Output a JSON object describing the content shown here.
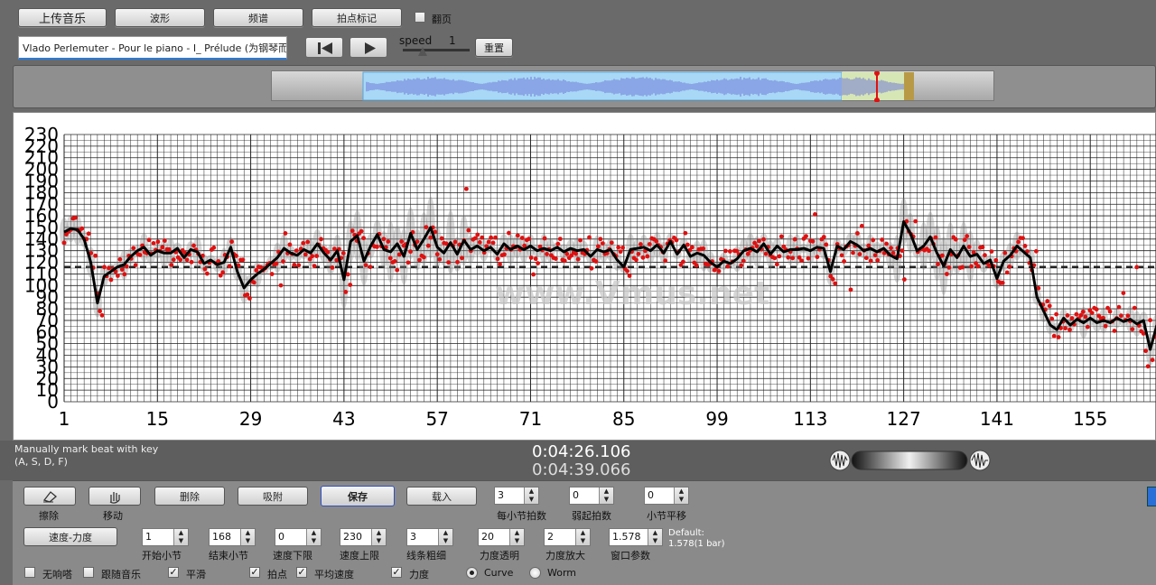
{
  "toolbar": {
    "upload": "上传音乐",
    "waveform": "波形",
    "spectrum": "频谱",
    "beat_mark": "拍点标记",
    "page_turn": "翻页",
    "page_turn_checked": false
  },
  "track": {
    "title": "Vlado Perlemuter - Pour le piano - I_ Prélude (为钢琴而作 - 前奏曲)",
    "speed_label": "speed",
    "speed_value": "1",
    "reset_label": "重置"
  },
  "watermark": "www.Vmus.net",
  "chart_data": {
    "type": "line+scatter",
    "yticks": [
      0,
      10,
      20,
      30,
      40,
      50,
      60,
      70,
      80,
      90,
      100,
      110,
      120,
      130,
      140,
      150,
      160,
      170,
      180,
      190,
      200,
      210,
      220,
      230
    ],
    "ylim": [
      0,
      230
    ],
    "xticks": [
      1,
      15,
      29,
      43,
      57,
      71,
      85,
      99,
      113,
      127,
      141,
      155
    ],
    "xlim": [
      1,
      168
    ],
    "visible_xlim": [
      1,
      165
    ],
    "reference_line": 116,
    "curve": [
      [
        1,
        146
      ],
      [
        2,
        149
      ],
      [
        3,
        148
      ],
      [
        4,
        140
      ],
      [
        5,
        120
      ],
      [
        6,
        85
      ],
      [
        7,
        108
      ],
      [
        8,
        112
      ],
      [
        9,
        116
      ],
      [
        10,
        118
      ],
      [
        11,
        125
      ],
      [
        12,
        130
      ],
      [
        13,
        133
      ],
      [
        14,
        126
      ],
      [
        15,
        130
      ],
      [
        16,
        128
      ],
      [
        17,
        128
      ],
      [
        18,
        132
      ],
      [
        19,
        124
      ],
      [
        20,
        131
      ],
      [
        21,
        129
      ],
      [
        22,
        119
      ],
      [
        23,
        122
      ],
      [
        24,
        118
      ],
      [
        25,
        120
      ],
      [
        26,
        133
      ],
      [
        27,
        112
      ],
      [
        28,
        98
      ],
      [
        29,
        105
      ],
      [
        30,
        110
      ],
      [
        31,
        114
      ],
      [
        32,
        119
      ],
      [
        33,
        124
      ],
      [
        34,
        132
      ],
      [
        35,
        128
      ],
      [
        36,
        126
      ],
      [
        37,
        131
      ],
      [
        38,
        128
      ],
      [
        39,
        136
      ],
      [
        40,
        128
      ],
      [
        41,
        122
      ],
      [
        42,
        130
      ],
      [
        43,
        105
      ],
      [
        44,
        138
      ],
      [
        45,
        143
      ],
      [
        46,
        121
      ],
      [
        47,
        134
      ],
      [
        48,
        144
      ],
      [
        49,
        131
      ],
      [
        50,
        129
      ],
      [
        51,
        136
      ],
      [
        52,
        125
      ],
      [
        53,
        145
      ],
      [
        54,
        131
      ],
      [
        55,
        140
      ],
      [
        56,
        150
      ],
      [
        57,
        133
      ],
      [
        58,
        128
      ],
      [
        59,
        137
      ],
      [
        60,
        127
      ],
      [
        61,
        139
      ],
      [
        62,
        131
      ],
      [
        63,
        134
      ],
      [
        64,
        130
      ],
      [
        65,
        133
      ],
      [
        66,
        127
      ],
      [
        67,
        136
      ],
      [
        68,
        131
      ],
      [
        69,
        134
      ],
      [
        70,
        131
      ],
      [
        71,
        134
      ],
      [
        72,
        130
      ],
      [
        73,
        132
      ],
      [
        74,
        130
      ],
      [
        75,
        133
      ],
      [
        76,
        129
      ],
      [
        77,
        132
      ],
      [
        78,
        130
      ],
      [
        79,
        131
      ],
      [
        80,
        125
      ],
      [
        81,
        131
      ],
      [
        82,
        129
      ],
      [
        83,
        131
      ],
      [
        84,
        122
      ],
      [
        85,
        116
      ],
      [
        86,
        131
      ],
      [
        87,
        132
      ],
      [
        88,
        133
      ],
      [
        89,
        130
      ],
      [
        90,
        135
      ],
      [
        91,
        128
      ],
      [
        92,
        138
      ],
      [
        93,
        127
      ],
      [
        94,
        135
      ],
      [
        95,
        125
      ],
      [
        96,
        128
      ],
      [
        97,
        126
      ],
      [
        98,
        120
      ],
      [
        99,
        116
      ],
      [
        100,
        121
      ],
      [
        101,
        119
      ],
      [
        102,
        123
      ],
      [
        103,
        130
      ],
      [
        104,
        132
      ],
      [
        105,
        129
      ],
      [
        106,
        136
      ],
      [
        107,
        127
      ],
      [
        108,
        134
      ],
      [
        109,
        129
      ],
      [
        110,
        131
      ],
      [
        111,
        131
      ],
      [
        112,
        132
      ],
      [
        113,
        130
      ],
      [
        114,
        133
      ],
      [
        115,
        132
      ],
      [
        116,
        112
      ],
      [
        117,
        134
      ],
      [
        118,
        131
      ],
      [
        119,
        138
      ],
      [
        120,
        135
      ],
      [
        121,
        130
      ],
      [
        122,
        132
      ],
      [
        123,
        129
      ],
      [
        124,
        132
      ],
      [
        125,
        126
      ],
      [
        126,
        123
      ],
      [
        127,
        155
      ],
      [
        128,
        145
      ],
      [
        129,
        130
      ],
      [
        130,
        134
      ],
      [
        131,
        142
      ],
      [
        132,
        128
      ],
      [
        133,
        117
      ],
      [
        134,
        131
      ],
      [
        135,
        124
      ],
      [
        136,
        134
      ],
      [
        137,
        125
      ],
      [
        138,
        127
      ],
      [
        139,
        119
      ],
      [
        140,
        122
      ],
      [
        141,
        106
      ],
      [
        142,
        121
      ],
      [
        143,
        126
      ],
      [
        144,
        134
      ],
      [
        145,
        129
      ],
      [
        146,
        124
      ],
      [
        147,
        90
      ],
      [
        148,
        78
      ],
      [
        149,
        66
      ],
      [
        150,
        62
      ],
      [
        151,
        72
      ],
      [
        152,
        66
      ],
      [
        153,
        71
      ],
      [
        154,
        68
      ],
      [
        155,
        72
      ],
      [
        156,
        68
      ],
      [
        157,
        70
      ],
      [
        158,
        68
      ],
      [
        159,
        72
      ],
      [
        160,
        69
      ],
      [
        161,
        71
      ],
      [
        162,
        67
      ],
      [
        163,
        70
      ],
      [
        164,
        45
      ],
      [
        165,
        66
      ]
    ],
    "scatter_count": 490
  },
  "status": {
    "hint_line1": "Manually mark beat with key",
    "hint_line2": "(A, S, D, F)",
    "time_current": "0:04:26.106",
    "time_total": "0:04:39.066"
  },
  "controls": {
    "erase": "擦除",
    "move": "移动",
    "delete": "删除",
    "snap": "吸附",
    "save": "保存",
    "load": "载入",
    "tempo_dynamics": "速度-力度",
    "beats_per_bar_label": "每小节拍数",
    "beats_per_bar": "3",
    "pickup_label": "弱起拍数",
    "pickup": "0",
    "bar_shift_label": "小节平移",
    "bar_shift": "0",
    "start_bar_label": "开始小节",
    "start_bar": "1",
    "end_bar_label": "结束小节",
    "end_bar": "168",
    "tempo_min_label": "速度下限",
    "tempo_min": "0",
    "tempo_max_label": "速度上限",
    "tempo_max": "230",
    "line_width_label": "线条粗细",
    "line_width": "3",
    "dyn_transparency_label": "力度透明",
    "dyn_transparency": "20",
    "dyn_scale_label": "力度放大",
    "dyn_scale": "2",
    "window_param_label": "窗口参数",
    "window_param": "1.578",
    "default_label": "Default:",
    "default_value": "1.578(1 bar)",
    "metronome": "无响嗒",
    "follow_music": "跟随音乐",
    "smooth": "平滑",
    "beats": "拍点",
    "avg_tempo": "平均速度",
    "dynamics": "力度",
    "curve": "Curve",
    "worm": "Worm"
  }
}
